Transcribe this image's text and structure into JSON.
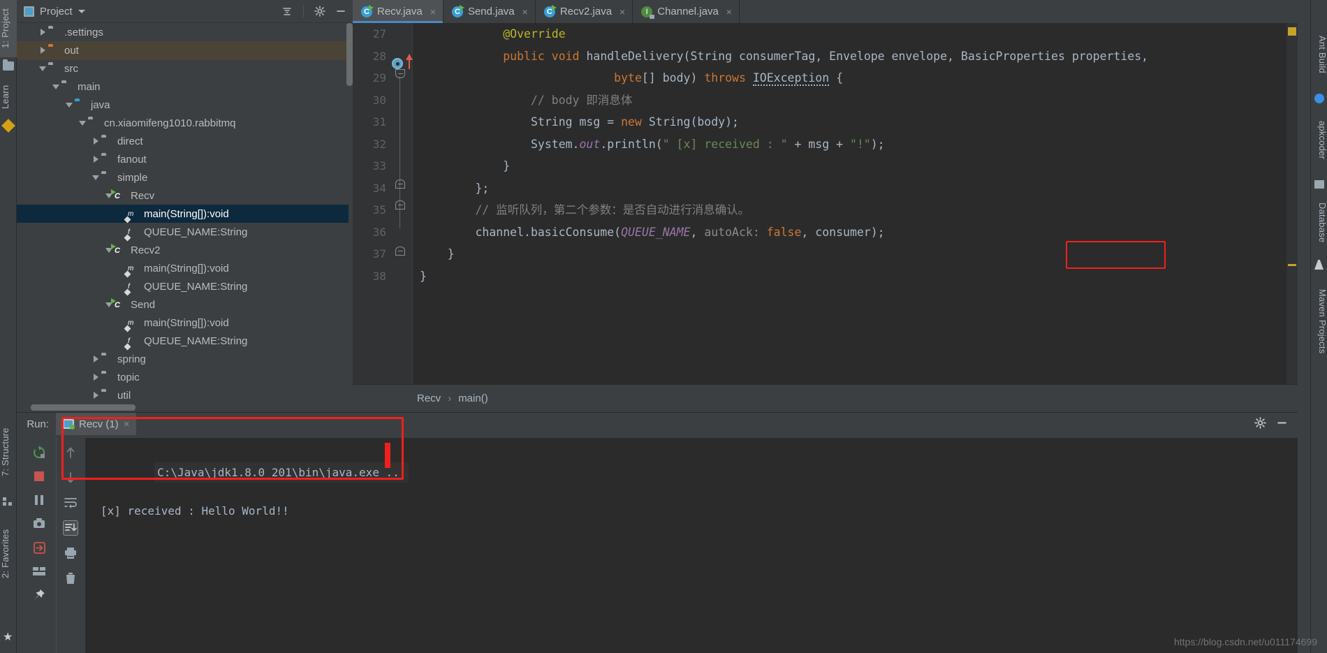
{
  "window": {
    "watermark": "https://blog.csdn.net/u011174699"
  },
  "left_rail": {
    "items": [
      {
        "label": "1: Project",
        "icon": "project-icon",
        "selected": true
      },
      {
        "label": "Learn",
        "icon": "learn-icon",
        "selected": false
      },
      {
        "label": "7: Structure",
        "icon": "structure-icon",
        "selected": false
      },
      {
        "label": "2: Favorites",
        "icon": "star-icon",
        "selected": false
      }
    ]
  },
  "right_rail": {
    "items": [
      {
        "label": "Ant Build"
      },
      {
        "label": "apkcoder"
      },
      {
        "label": "Database"
      },
      {
        "label": "Maven Projects"
      }
    ]
  },
  "project_panel": {
    "title": "Project",
    "collapse_all_tooltip": "Collapse All",
    "settings_tooltip": "Settings",
    "minimize_tooltip": "Hide",
    "tree": [
      {
        "label": ".settings",
        "indent": 1,
        "twisty": "right",
        "icon": "folder-icon",
        "state": "normal"
      },
      {
        "label": "out",
        "indent": 1,
        "twisty": "right",
        "icon": "folder-orange-icon",
        "state": "highlight"
      },
      {
        "label": "src",
        "indent": 1,
        "twisty": "down",
        "icon": "folder-icon",
        "state": "normal"
      },
      {
        "label": "main",
        "indent": 2,
        "twisty": "down",
        "icon": "folder-icon",
        "state": "normal"
      },
      {
        "label": "java",
        "indent": 3,
        "twisty": "down",
        "icon": "folder-blue-icon",
        "state": "normal"
      },
      {
        "label": "cn.xiaomifeng1010.rabbitmq",
        "indent": 4,
        "twisty": "down",
        "icon": "package-icon",
        "state": "normal"
      },
      {
        "label": "direct",
        "indent": 5,
        "twisty": "right",
        "icon": "package-icon",
        "state": "normal"
      },
      {
        "label": "fanout",
        "indent": 5,
        "twisty": "right",
        "icon": "package-icon",
        "state": "normal"
      },
      {
        "label": "simple",
        "indent": 5,
        "twisty": "down",
        "icon": "package-icon",
        "state": "normal"
      },
      {
        "label": "Recv",
        "indent": 6,
        "twisty": "down",
        "icon": "class-icon",
        "state": "normal"
      },
      {
        "label": "main(String[]):void",
        "indent": 7,
        "twisty": "none",
        "icon": "method-icon",
        "state": "selected"
      },
      {
        "label": "QUEUE_NAME:String",
        "indent": 7,
        "twisty": "none",
        "icon": "field-icon",
        "state": "normal"
      },
      {
        "label": "Recv2",
        "indent": 6,
        "twisty": "down",
        "icon": "class-icon",
        "state": "normal"
      },
      {
        "label": "main(String[]):void",
        "indent": 7,
        "twisty": "none",
        "icon": "method-icon",
        "state": "normal"
      },
      {
        "label": "QUEUE_NAME:String",
        "indent": 7,
        "twisty": "none",
        "icon": "field-icon",
        "state": "normal"
      },
      {
        "label": "Send",
        "indent": 6,
        "twisty": "down",
        "icon": "class-icon",
        "state": "normal"
      },
      {
        "label": "main(String[]):void",
        "indent": 7,
        "twisty": "none",
        "icon": "method-icon",
        "state": "normal"
      },
      {
        "label": "QUEUE_NAME:String",
        "indent": 7,
        "twisty": "none",
        "icon": "field-icon",
        "state": "normal"
      },
      {
        "label": "spring",
        "indent": 5,
        "twisty": "right",
        "icon": "package-icon",
        "state": "normal"
      },
      {
        "label": "topic",
        "indent": 5,
        "twisty": "right",
        "icon": "package-icon",
        "state": "normal"
      },
      {
        "label": "util",
        "indent": 5,
        "twisty": "right",
        "icon": "package-icon",
        "state": "normal"
      }
    ]
  },
  "editor": {
    "tabs": [
      {
        "label": "Recv.java",
        "icon": "java-class-icon",
        "active": true,
        "closable": true
      },
      {
        "label": "Send.java",
        "icon": "java-class-icon",
        "active": false,
        "closable": true
      },
      {
        "label": "Recv2.java",
        "icon": "java-class-icon",
        "active": false,
        "closable": true
      },
      {
        "label": "Channel.java",
        "icon": "java-interface-icon",
        "active": false,
        "closable": true
      }
    ],
    "first_line_number": 27,
    "lines": [
      {
        "num": 27,
        "tokens": [
          {
            "t": "            ",
            "c": "plain"
          },
          {
            "t": "@Override",
            "c": "ann"
          }
        ]
      },
      {
        "num": 28,
        "tokens": [
          {
            "t": "            ",
            "c": "plain"
          },
          {
            "t": "public",
            "c": "kw"
          },
          {
            "t": " ",
            "c": "plain"
          },
          {
            "t": "void",
            "c": "kw"
          },
          {
            "t": " handleDelivery",
            "c": "plain"
          },
          {
            "t": "(",
            "c": "plain"
          },
          {
            "t": "String consumerTag",
            "c": "plain"
          },
          {
            "t": ", Envelope envelope, BasicProperties properties,",
            "c": "plain"
          }
        ]
      },
      {
        "num": 29,
        "tokens": [
          {
            "t": "                            ",
            "c": "plain"
          },
          {
            "t": "byte",
            "c": "kw"
          },
          {
            "t": "[] body) ",
            "c": "plain"
          },
          {
            "t": "throws",
            "c": "kw"
          },
          {
            "t": " ",
            "c": "plain"
          },
          {
            "t": "IOException",
            "c": "wavy"
          },
          {
            "t": " {",
            "c": "plain"
          }
        ]
      },
      {
        "num": 30,
        "tokens": [
          {
            "t": "                ",
            "c": "plain"
          },
          {
            "t": "// body 即消息体",
            "c": "cmt"
          }
        ]
      },
      {
        "num": 31,
        "tokens": [
          {
            "t": "                ",
            "c": "plain"
          },
          {
            "t": "String msg = ",
            "c": "plain"
          },
          {
            "t": "new",
            "c": "kw"
          },
          {
            "t": " String(body);",
            "c": "plain"
          }
        ]
      },
      {
        "num": 32,
        "tokens": [
          {
            "t": "                ",
            "c": "plain"
          },
          {
            "t": "System.",
            "c": "plain"
          },
          {
            "t": "out",
            "c": "statfld"
          },
          {
            "t": ".println(",
            "c": "plain"
          },
          {
            "t": "\" [x] received : \"",
            "c": "str"
          },
          {
            "t": " + msg + ",
            "c": "plain"
          },
          {
            "t": "\"!\"",
            "c": "str"
          },
          {
            "t": ");",
            "c": "plain"
          }
        ]
      },
      {
        "num": 33,
        "tokens": [
          {
            "t": "            }",
            "c": "plain"
          }
        ]
      },
      {
        "num": 34,
        "tokens": [
          {
            "t": "        };",
            "c": "plain"
          }
        ]
      },
      {
        "num": 35,
        "tokens": [
          {
            "t": "        ",
            "c": "plain"
          },
          {
            "t": "// 监听队列，第二个参数：是否自动进行消息确认。",
            "c": "cmt"
          }
        ]
      },
      {
        "num": 36,
        "tokens": [
          {
            "t": "        channel.basicConsume(",
            "c": "plain"
          },
          {
            "t": "QUEUE_NAME",
            "c": "fldref"
          },
          {
            "t": ", ",
            "c": "plain"
          },
          {
            "t": "autoAck:",
            "c": "param-hint"
          },
          {
            "t": " ",
            "c": "plain"
          },
          {
            "t": "false",
            "c": "kw"
          },
          {
            "t": ", consumer);",
            "c": "plain"
          }
        ]
      },
      {
        "num": 37,
        "tokens": [
          {
            "t": "    }",
            "c": "plain"
          }
        ]
      },
      {
        "num": 38,
        "tokens": [
          {
            "t": "}",
            "c": "plain"
          }
        ]
      }
    ],
    "breadcrumb": [
      "Recv",
      "main()"
    ],
    "breadcrumb_separator": "›"
  },
  "run_panel": {
    "label": "Run:",
    "tab_label": "Recv (1)",
    "tab_close": "×",
    "settings_tooltip": "Settings",
    "minimize_tooltip": "Hide",
    "console": [
      {
        "text": "C:\\Java\\jdk1.8.0_201\\bin\\java.exe ...",
        "style": "command"
      },
      {
        "text": "[x] received : Hello World!!",
        "style": "output"
      }
    ],
    "toolbar_left": [
      {
        "name": "rerun-icon",
        "glyph": "↻"
      },
      {
        "name": "stop-icon",
        "glyph": "■"
      },
      {
        "name": "pause-icon",
        "glyph": "‖"
      },
      {
        "name": "dump-threads-icon",
        "glyph": "◎"
      },
      {
        "name": "exit-icon",
        "glyph": "⇥"
      },
      {
        "name": "layout-icon",
        "glyph": "▤"
      },
      {
        "name": "pin-icon",
        "glyph": "✒"
      }
    ],
    "toolbar_right": [
      {
        "name": "up-arrow-icon",
        "glyph": "↑"
      },
      {
        "name": "down-arrow-icon",
        "glyph": "↓"
      },
      {
        "name": "soft-wrap-icon",
        "glyph": "↵"
      },
      {
        "name": "scroll-to-end-icon",
        "glyph": "↧"
      },
      {
        "name": "print-icon",
        "glyph": "⎙"
      },
      {
        "name": "clear-all-icon",
        "glyph": "🗑"
      }
    ]
  },
  "colors": {
    "accent": "#4a88c7",
    "highlight_box": "#f21f1f",
    "selection": "#0d293e",
    "editor_bg": "#2b2b2b",
    "panel_bg": "#3c3f41"
  }
}
